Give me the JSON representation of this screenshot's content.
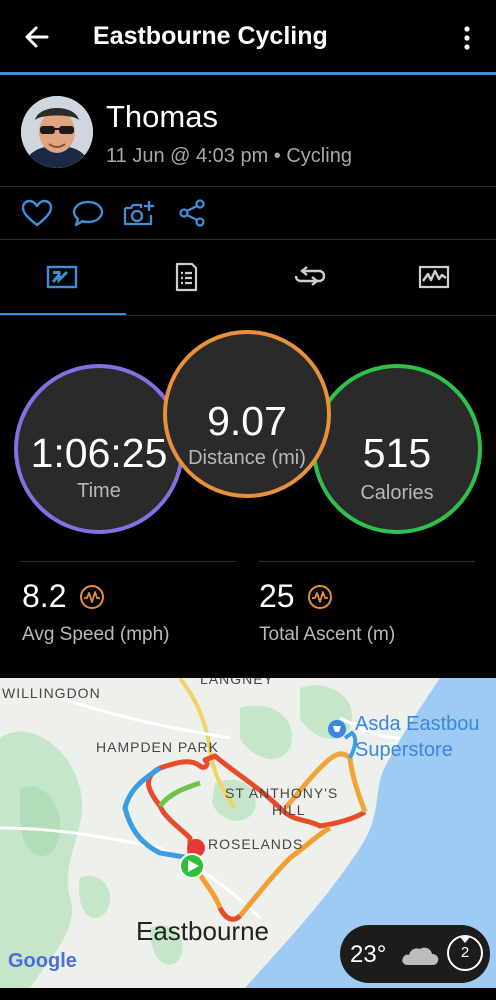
{
  "header": {
    "title": "Eastbourne Cycling",
    "back_icon": "back-arrow-icon",
    "menu_icon": "more-vertical-icon"
  },
  "profile": {
    "name": "Thomas",
    "subtitle": "11 Jun @ 4:03 pm • Cycling"
  },
  "actions": [
    "like-icon",
    "comment-icon",
    "add-photo-icon",
    "share-icon"
  ],
  "tabs": [
    {
      "icon": "overview-tab-icon",
      "selected": true
    },
    {
      "icon": "details-tab-icon",
      "selected": false
    },
    {
      "icon": "laps-tab-icon",
      "selected": false
    },
    {
      "icon": "charts-tab-icon",
      "selected": false
    }
  ],
  "summary": {
    "time": {
      "value": "1:06:25",
      "label": "Time",
      "color": "#8470e0"
    },
    "distance": {
      "value": "9.07",
      "label": "Distance (mi)",
      "color": "#e8913a"
    },
    "calories": {
      "value": "515",
      "label": "Calories",
      "color": "#2fc24a"
    }
  },
  "stats": {
    "avg_speed": {
      "value": "8.2",
      "label": "Avg Speed (mph)"
    },
    "total_ascent": {
      "value": "25",
      "label": "Total Ascent (m)"
    }
  },
  "map": {
    "places": {
      "willingdon": "WILLINGDON",
      "langney": "LANGNEY",
      "hampden_park": "HAMPDEN PARK",
      "st_anthonys_1": "ST ANTHONY'S",
      "st_anthonys_2": "HILL",
      "roselands": "ROSELANDS",
      "eastbourne": "Eastbourne",
      "asda_1": "Asda Eastbou",
      "asda_2": "Superstore"
    },
    "google": "Google"
  },
  "weather": {
    "temperature": "23°",
    "wind_speed": "2",
    "condition_icon": "cloud-icon"
  },
  "colors": {
    "accent": "#3f8fd8",
    "sea": "#9ecbf3",
    "land": "#eef0ec",
    "park": "#c5e6c9"
  }
}
